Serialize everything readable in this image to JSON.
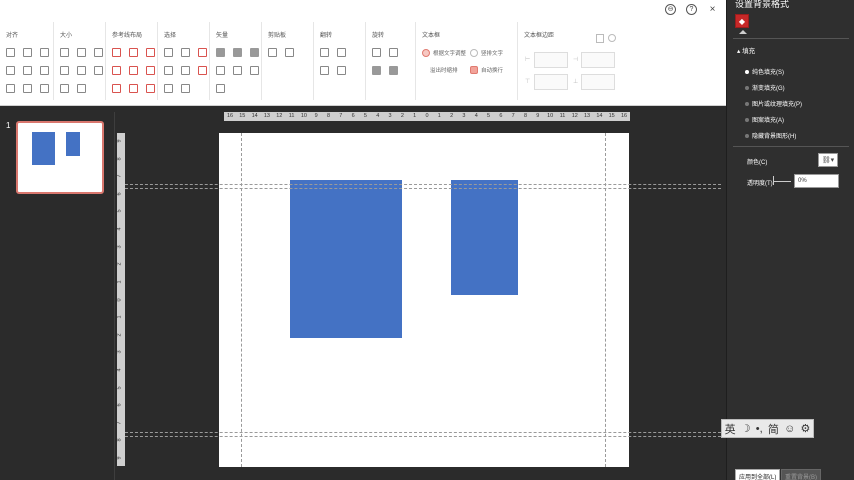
{
  "ribbon": {
    "groups": {
      "align": "对齐",
      "size": "大小",
      "guides": "参考线布局",
      "select": "选择",
      "vector": "矢量",
      "clipboard": "剪贴板",
      "flip": "翻转",
      "rotate": "旋转",
      "textbox": "文本框",
      "margin": "文本框边距"
    },
    "textbox_options": {
      "shrink": "溢出时缩排",
      "autofit_shape": "根据文字调整",
      "vertical_text": "竖排文字",
      "autowrap": "自动换行"
    },
    "window_controls": [
      "⊖",
      "?",
      "×"
    ]
  },
  "pane": {
    "title": "设置背景格式",
    "section": "填充",
    "fill_options": [
      "纯色填充(S)",
      "渐变填充(G)",
      "图片或纹理填充(P)",
      "图案填充(A)",
      "隐藏背景图形(H)"
    ],
    "selected_fill": "纯色填充(S)",
    "color_label": "颜色(C)",
    "transparency_label": "透明度(T)",
    "transparency_value": "0%",
    "apply_all_button": "应用到全部(L)",
    "reset_button": "重置背景(B)",
    "fill_icon": "paint-bucket-icon"
  },
  "ime": [
    "英",
    "☽",
    "•,",
    "简",
    "☺",
    "⚙"
  ],
  "thumbnail": {
    "slide_number": "1"
  },
  "ruler": {
    "horizontal": [
      "16",
      "15",
      "14",
      "13",
      "12",
      "11",
      "10",
      "9",
      "8",
      "7",
      "6",
      "5",
      "4",
      "3",
      "2",
      "1",
      "0",
      "1",
      "2",
      "3",
      "4",
      "5",
      "6",
      "7",
      "8",
      "9",
      "10",
      "11",
      "12",
      "13",
      "14",
      "15",
      "16"
    ],
    "vertical": [
      "9",
      "8",
      "7",
      "6",
      "5",
      "4",
      "3",
      "2",
      "1",
      "0",
      "1",
      "2",
      "3",
      "4",
      "5",
      "6",
      "7",
      "8",
      "9"
    ]
  },
  "colors": {
    "shape_fill": "#4472c4",
    "accent": "#c62828",
    "selection_border": "#d9776e"
  }
}
